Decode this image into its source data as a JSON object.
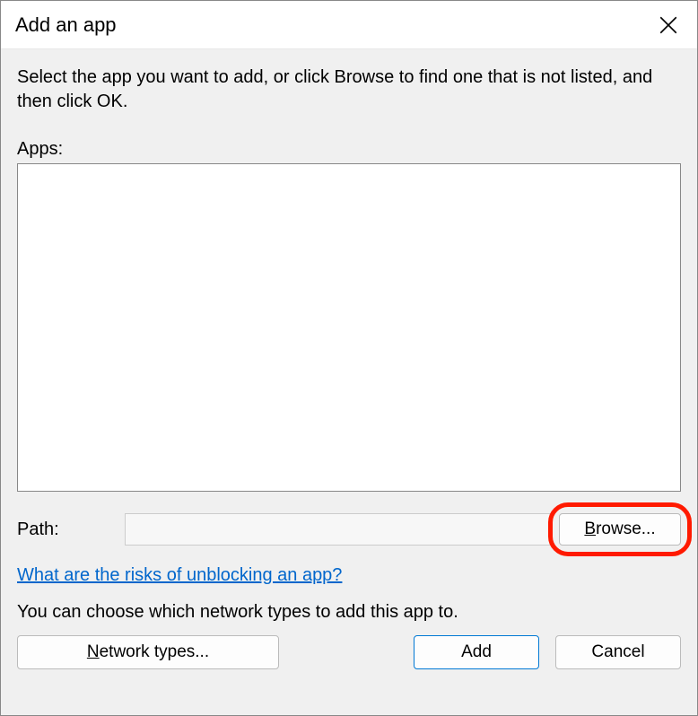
{
  "title": "Add an app",
  "instruction": "Select the app you want to add, or click Browse to find one that is not listed, and then click OK.",
  "apps_label": "Apps:",
  "path_label": "Path:",
  "path_value": "",
  "browse_first": "B",
  "browse_rest": "rowse...",
  "risk_link": "What are the risks of unblocking an app?",
  "network_note": "You can choose which network types to add this app to.",
  "buttons": {
    "network_types_first": "N",
    "network_types_rest": "etwork types...",
    "add": "Add",
    "cancel": "Cancel"
  }
}
